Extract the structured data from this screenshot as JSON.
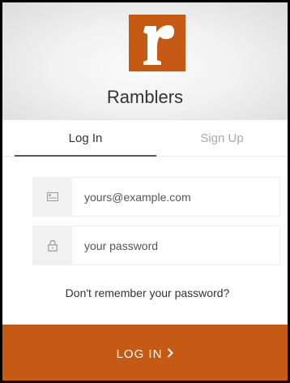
{
  "app": {
    "name": "Ramblers",
    "brand_color": "#c55a15"
  },
  "tabs": [
    {
      "label": "Log In",
      "active": true
    },
    {
      "label": "Sign Up",
      "active": false
    }
  ],
  "form": {
    "email": {
      "placeholder": "yours@example.com",
      "value": "",
      "icon": "envelope-icon"
    },
    "password": {
      "placeholder": "your password",
      "value": "",
      "icon": "lock-icon"
    },
    "forgot_link": "Don't remember your password?",
    "submit_label": "LOG IN",
    "submit_icon": "chevron-right-icon"
  }
}
